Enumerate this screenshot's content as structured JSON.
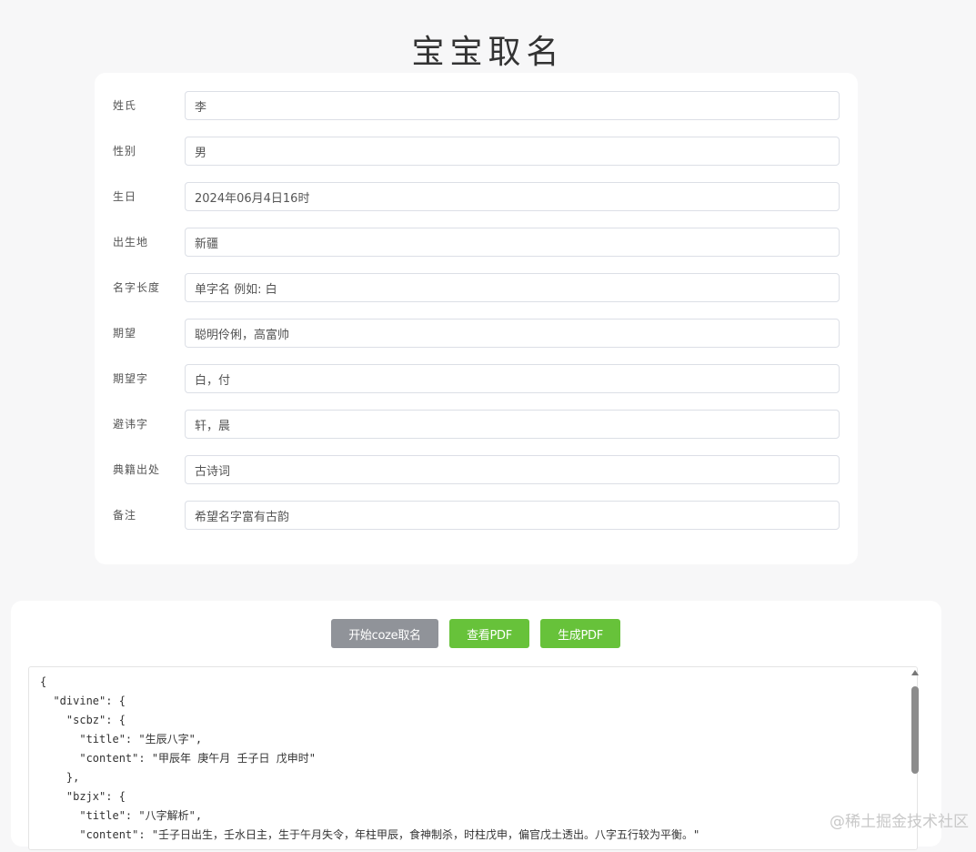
{
  "page": {
    "title": "宝宝取名"
  },
  "form": {
    "fields": [
      {
        "label": "姓氏",
        "value": "李"
      },
      {
        "label": "性别",
        "value": "男"
      },
      {
        "label": "生日",
        "value": "2024年06月4日16时"
      },
      {
        "label": "出生地",
        "value": "新疆"
      },
      {
        "label": "名字长度",
        "value": "单字名 例如: 白"
      },
      {
        "label": "期望",
        "value": "聪明伶俐，高富帅"
      },
      {
        "label": "期望字",
        "value": "白，付"
      },
      {
        "label": "避讳字",
        "value": "轩，晨"
      },
      {
        "label": "典籍出处",
        "value": "古诗词"
      },
      {
        "label": "备注",
        "value": "希望名字富有古韵"
      }
    ]
  },
  "actions": {
    "start_label": "开始coze取名",
    "view_pdf_label": "查看PDF",
    "generate_pdf_label": "生成PDF"
  },
  "result": {
    "json_text": "{\n  \"divine\": {\n    \"scbz\": {\n      \"title\": \"生辰八字\",\n      \"content\": \"甲辰年 庚午月 壬子日 戊申时\"\n    },\n    \"bzjx\": {\n      \"title\": \"八字解析\",\n      \"content\": \"壬子日出生，壬水日主，生于午月失令，年柱甲辰，食神制杀，时柱戊申，偏官戊土透出。八字五行较为平衡。\""
  },
  "watermark": {
    "text": "@稀土掘金技术社区"
  },
  "colors": {
    "gray_button": "#909399",
    "green_button": "#67c23a",
    "background": "#f7f7f8"
  }
}
